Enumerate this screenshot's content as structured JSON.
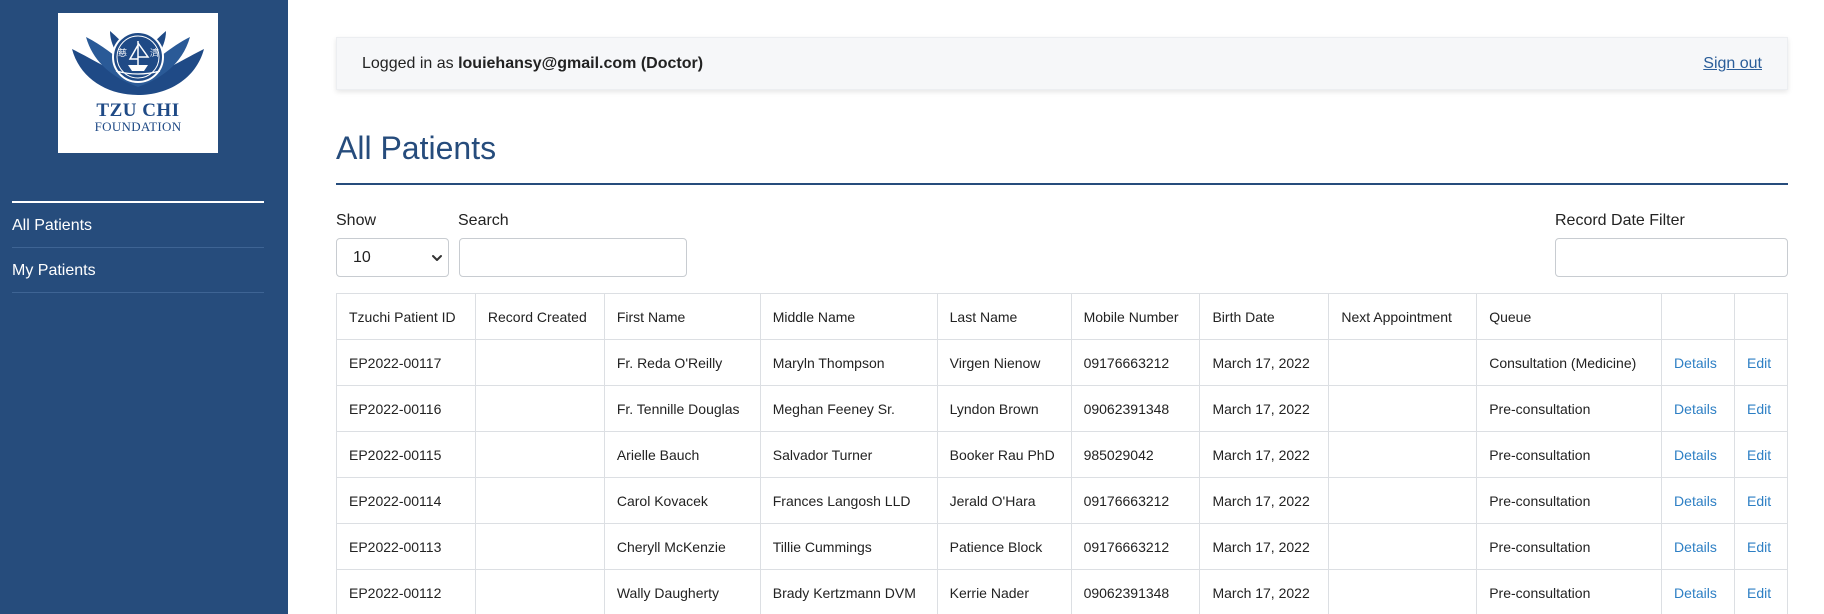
{
  "sidebar": {
    "logo": {
      "line1": "TZU CHI",
      "line2": "FOUNDATION",
      "seal_chars": [
        "慈",
        "濟"
      ]
    },
    "items": [
      {
        "label": "All Patients"
      },
      {
        "label": "My Patients"
      }
    ]
  },
  "header": {
    "login_prefix": "Logged in as ",
    "user": "louiehansy@gmail.com (Doctor)",
    "signout": "Sign out"
  },
  "page": {
    "title": "All Patients"
  },
  "controls": {
    "show_label": "Show",
    "show_value": "10",
    "search_label": "Search",
    "search_value": "",
    "date_filter_label": "Record Date Filter",
    "date_filter_value": ""
  },
  "table": {
    "columns": [
      "Tzuchi Patient ID",
      "Record Created",
      "First Name",
      "Middle Name",
      "Last Name",
      "Mobile Number",
      "Birth Date",
      "Next Appointment",
      "Queue",
      "",
      ""
    ],
    "rows": [
      [
        "EP2022-00117",
        "",
        "Fr. Reda O'Reilly",
        "Maryln Thompson",
        "Virgen Nienow",
        "09176663212",
        "March 17, 2022",
        "",
        "Consultation (Medicine)",
        "Details",
        "Edit"
      ],
      [
        "EP2022-00116",
        "",
        "Fr. Tennille Douglas",
        "Meghan Feeney Sr.",
        "Lyndon Brown",
        "09062391348",
        "March 17, 2022",
        "",
        "Pre-consultation",
        "Details",
        "Edit"
      ],
      [
        "EP2022-00115",
        "",
        "Arielle Bauch",
        "Salvador Turner",
        "Booker Rau PhD",
        "985029042",
        "March 17, 2022",
        "",
        "Pre-consultation",
        "Details",
        "Edit"
      ],
      [
        "EP2022-00114",
        "",
        "Carol Kovacek",
        "Frances Langosh LLD",
        "Jerald O'Hara",
        "09176663212",
        "March 17, 2022",
        "",
        "Pre-consultation",
        "Details",
        "Edit"
      ],
      [
        "EP2022-00113",
        "",
        "Cheryll McKenzie",
        "Tillie Cummings",
        "Patience Block",
        "09176663212",
        "March 17, 2022",
        "",
        "Pre-consultation",
        "Details",
        "Edit"
      ],
      [
        "EP2022-00112",
        "",
        "Wally Daugherty",
        "Brady Kertzmann DVM",
        "Kerrie Nader",
        "09062391348",
        "March 17, 2022",
        "",
        "Pre-consultation",
        "Details",
        "Edit"
      ]
    ]
  },
  "colors": {
    "sidebar": "#264c7c",
    "accent": "#264c7c",
    "link": "#2d7fc4",
    "topbar": "#f6f7f9"
  },
  "icons": {
    "logo": "tzu-chi-logo",
    "select": "chevron-down-icon"
  }
}
